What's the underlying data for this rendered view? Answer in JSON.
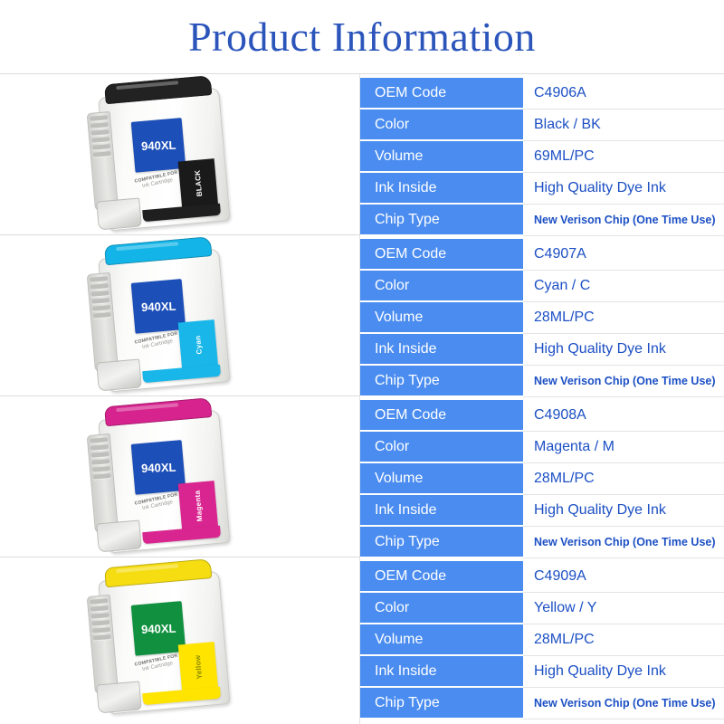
{
  "header": {
    "title": "Product Information",
    "title_color": "#2b55bb"
  },
  "theme": {
    "label_bg": "#4a8cf0",
    "label_text": "#ffffff",
    "value_text": "#1b4fc4",
    "divider": "#dcdcdc"
  },
  "spec_labels": {
    "oem_code": "OEM Code",
    "color": "Color",
    "volume": "Volume",
    "ink_inside": "Ink Inside",
    "chip_type": "Chip Type"
  },
  "cartridge_common": {
    "model": "940XL",
    "compatible_line1": "COMPATIBLE FOR",
    "compatible_line2": "Ink Cartridge"
  },
  "products": [
    {
      "oem_code": "C4906A",
      "color": "Black / BK",
      "volume": "69ML/PC",
      "ink_inside": "High Quality Dye Ink",
      "chip_type": "New Verison Chip (One Time Use)",
      "cartridge": {
        "swatch_label": "BLACK",
        "cap_color": "#222222",
        "label_color": "#1d4fb8",
        "swatch_color": "#1a1a1a",
        "swatch_text_color": "#ffffff",
        "foot_color": "#1f1f1f",
        "model": "940XL"
      }
    },
    {
      "oem_code": "C4907A",
      "color": "Cyan / C",
      "volume": "28ML/PC",
      "ink_inside": "High Quality Dye Ink",
      "chip_type": "New Verison Chip (One Time Use)",
      "cartridge": {
        "swatch_label": "Cyan",
        "cap_color": "#13b5e8",
        "label_color": "#1d4fb8",
        "swatch_color": "#19b6ea",
        "swatch_text_color": "#ffffff",
        "foot_color": "#19b6ea",
        "model": "940XL"
      }
    },
    {
      "oem_code": "C4908A",
      "color": "Magenta / M",
      "volume": "28ML/PC",
      "ink_inside": "High Quality Dye Ink",
      "chip_type": "New Verison Chip (One Time Use)",
      "cartridge": {
        "swatch_label": "Magenta",
        "cap_color": "#d6238e",
        "label_color": "#1d4fb8",
        "swatch_color": "#d9258f",
        "swatch_text_color": "#ffffff",
        "foot_color": "#d9258f",
        "model": "940XL"
      }
    },
    {
      "oem_code": "C4909A",
      "color": "Yellow / Y",
      "volume": "28ML/PC",
      "ink_inside": "High Quality Dye Ink",
      "chip_type": "New Verison Chip (One Time Use)",
      "cartridge": {
        "swatch_label": "Yellow",
        "cap_color": "#f5dd12",
        "label_color": "#11913f",
        "swatch_color": "#ffe400",
        "swatch_text_color": "#8a8a00",
        "foot_color": "#ffe400",
        "model": "940XL"
      }
    }
  ]
}
